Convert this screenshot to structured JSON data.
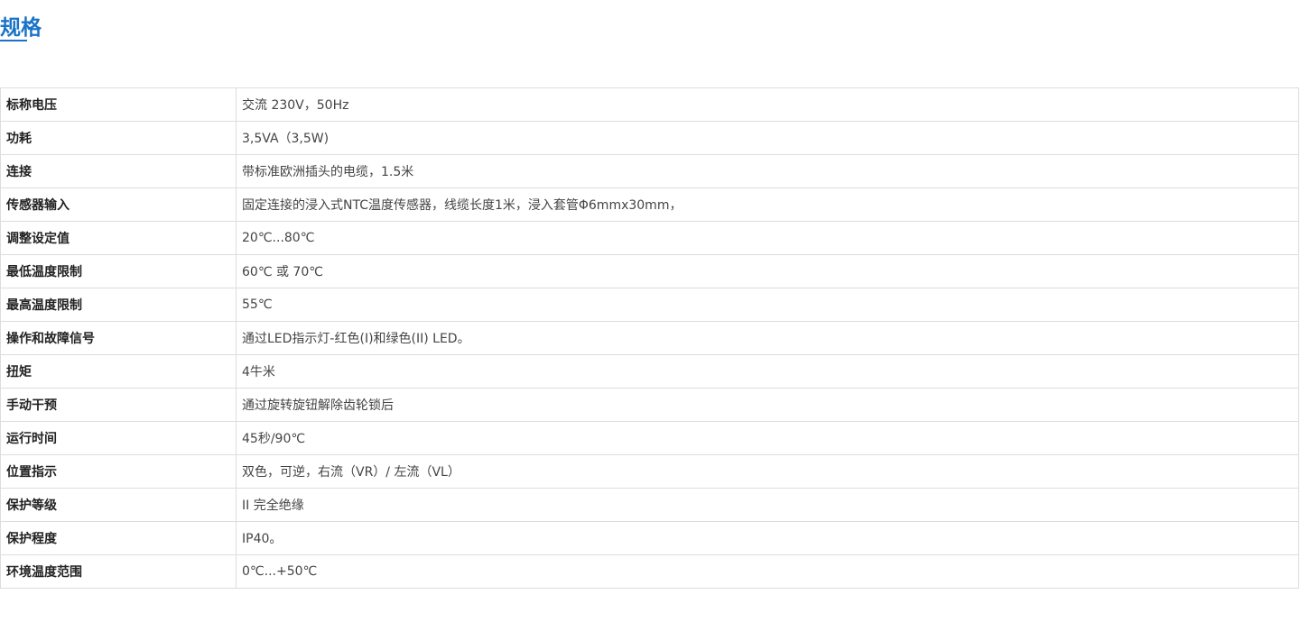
{
  "section": {
    "title": "规格",
    "accent_color": "#1a73c8"
  },
  "specs": [
    {
      "label": "标称电压",
      "value": "交流 230V，50Hz"
    },
    {
      "label": "功耗",
      "value": "3,5VA（3,5W)"
    },
    {
      "label": "连接",
      "value": "带标准欧洲插头的电缆，1.5米"
    },
    {
      "label": "传感器输入",
      "value": "固定连接的浸入式NTC温度传感器，线缆长度1米，浸入套管Φ6mmx30mm，"
    },
    {
      "label": "调整设定值",
      "value": "20℃...80℃"
    },
    {
      "label": "最低温度限制",
      "value": "60℃ 或 70℃"
    },
    {
      "label": "最高温度限制",
      "value": "55℃"
    },
    {
      "label": "操作和故障信号",
      "value": "通过LED指示灯-红色(I)和绿色(II) LED。"
    },
    {
      "label": "扭矩",
      "value": "4牛米"
    },
    {
      "label": "手动干预",
      "value": "通过旋转旋钮解除齿轮锁后"
    },
    {
      "label": "运行时间",
      "value": "45秒/90℃"
    },
    {
      "label": "位置指示",
      "value": "双色，可逆，右流（VR）/ 左流（VL）"
    },
    {
      "label": "保护等级",
      "value": "II 完全绝缘"
    },
    {
      "label": "保护程度",
      "value": "IP40。"
    },
    {
      "label": "环境温度范围",
      "value": "0℃...+50℃"
    }
  ]
}
